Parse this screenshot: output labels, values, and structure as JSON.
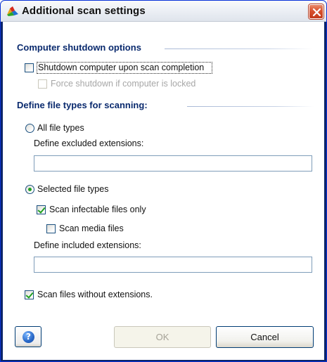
{
  "window": {
    "title": "Additional scan settings"
  },
  "shutdown_section": {
    "title": "Computer shutdown options",
    "shutdown_on_completion": {
      "label": "Shutdown computer upon scan completion",
      "checked": false
    },
    "force_shutdown_locked": {
      "label": "Force shutdown if computer is locked",
      "checked": false,
      "enabled": false
    }
  },
  "filetypes_section": {
    "title": "Define file types for scanning:",
    "all_file_types": {
      "label": "All file types",
      "selected": false
    },
    "excluded_extensions": {
      "label": "Define excluded extensions:",
      "value": ""
    },
    "selected_file_types": {
      "label": "Selected file types",
      "selected": true
    },
    "scan_infectable_only": {
      "label": "Scan infectable files only",
      "checked": true
    },
    "scan_media_files": {
      "label": "Scan media files",
      "checked": false
    },
    "included_extensions": {
      "label": "Define included extensions:",
      "value": ""
    },
    "scan_without_extensions": {
      "label": "Scan files without extensions.",
      "checked": true
    }
  },
  "footer": {
    "help_symbol": "?",
    "ok_label": "OK",
    "cancel_label": "Cancel"
  },
  "icons": {
    "title_icon": "avg-logo-icon",
    "close_icon": "close-icon",
    "help_icon": "help-icon"
  },
  "colors": {
    "frame": "#0A246A",
    "section_title": "#0A2A6E",
    "check_mark": "#21a121",
    "close_button": "#d8512d"
  }
}
